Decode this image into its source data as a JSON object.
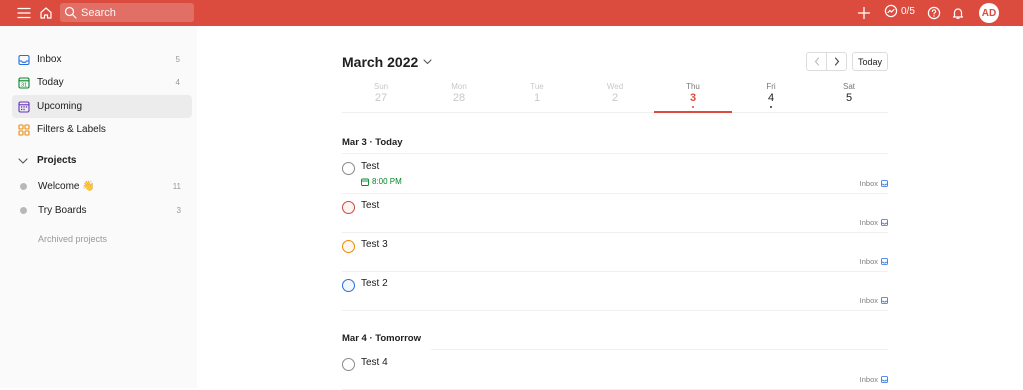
{
  "topbar": {
    "search_placeholder": "Search",
    "karma": "0/5",
    "avatar": "AD"
  },
  "sidebar": {
    "items": [
      {
        "label": "Inbox",
        "count": "5",
        "icon": "inbox-icon"
      },
      {
        "label": "Today",
        "count": "4",
        "icon": "calendar-today-icon"
      },
      {
        "label": "Upcoming",
        "count": "",
        "icon": "calendar-upcoming-icon"
      },
      {
        "label": "Filters & Labels",
        "count": "",
        "icon": "filters-icon"
      }
    ],
    "projects_heading": "Projects",
    "projects": [
      {
        "label": "Welcome 👋",
        "count": "11"
      },
      {
        "label": "Try Boards",
        "count": "3"
      }
    ],
    "archived": "Archived projects"
  },
  "header": {
    "month": "March 2022",
    "today_button": "Today"
  },
  "days": [
    {
      "name": "Sun",
      "num": "27"
    },
    {
      "name": "Mon",
      "num": "28"
    },
    {
      "name": "Tue",
      "num": "1"
    },
    {
      "name": "Wed",
      "num": "2"
    },
    {
      "name": "Thu",
      "num": "3"
    },
    {
      "name": "Fri",
      "num": "4"
    },
    {
      "name": "Sat",
      "num": "5"
    }
  ],
  "sections": [
    {
      "title": "Mar 3 · Today",
      "tasks": [
        {
          "name": "Test",
          "due": "8:00 PM",
          "project": "Inbox"
        },
        {
          "name": "Test",
          "project": "Inbox"
        },
        {
          "name": "Test 3",
          "project": "Inbox"
        },
        {
          "name": "Test 2",
          "project": "Inbox"
        }
      ]
    },
    {
      "title": "Mar 4 · Tomorrow",
      "tasks": [
        {
          "name": "Test 4",
          "project": "Inbox"
        }
      ]
    }
  ],
  "colors": {
    "brand": "#db4c3f",
    "priority1": "#d1453b",
    "priority2": "#eb8909",
    "priority3": "#246fe0",
    "due_green": "#058527"
  }
}
